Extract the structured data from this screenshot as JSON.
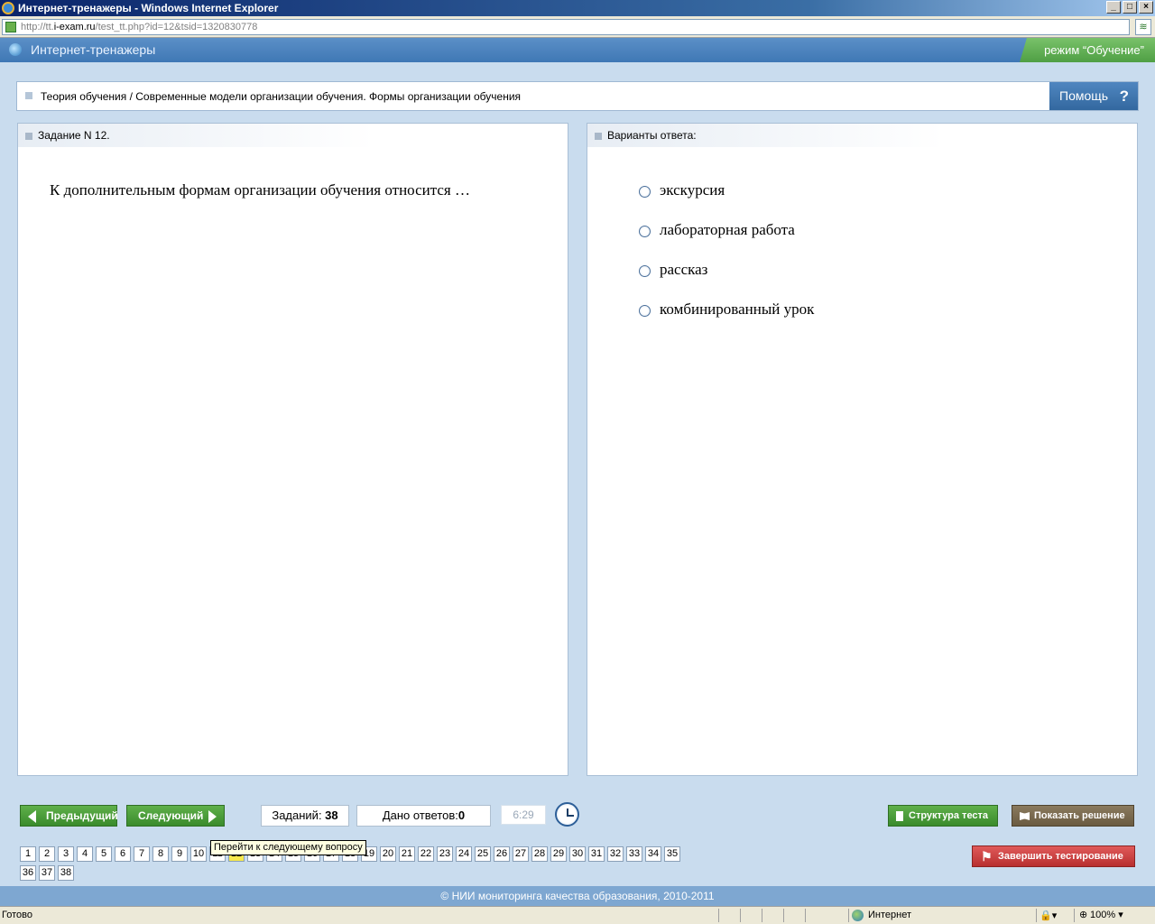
{
  "window": {
    "title": "Интернет-тренажеры - Windows Internet Explorer",
    "buttons": [
      "_",
      "□",
      "×"
    ]
  },
  "address_bar": {
    "url_prefix": "http://tt.",
    "url_domain": "i-exam.ru",
    "url_rest": "/test_tt.php?id=12&tsid=1320830778"
  },
  "app": {
    "title": "Интернет-тренажеры",
    "mode": "режим “Обучение”"
  },
  "breadcrumb": {
    "text": "Теория обучения / Современные модели организации обучения. Формы организации обучения",
    "help_label": "Помощь",
    "help_icon": "?"
  },
  "task": {
    "header": "Задание N 12.",
    "question": "К дополнительным формам организации обучения относится …"
  },
  "answers": {
    "header": "Варианты ответа:",
    "options": [
      "экскурсия",
      "лабораторная работа",
      "рассказ",
      "комбинированный урок"
    ]
  },
  "navigation": {
    "prev_label": "Предыдущий",
    "next_label": "Следующий",
    "tasks_label": "Заданий: ",
    "tasks_count": "38",
    "answers_label": "Дано ответов:",
    "answers_count": "0",
    "timer": "6:29",
    "structure_label": "Структура теста",
    "solution_label": "Показать решение",
    "finish_label": "Завершить тестирование",
    "tooltip": "Перейти к следующему вопросу",
    "current_page": 12
  },
  "pages": [
    "1",
    "2",
    "3",
    "4",
    "5",
    "6",
    "7",
    "8",
    "9",
    "10",
    "11",
    "12",
    "13",
    "14",
    "15",
    "16",
    "17",
    "18",
    "19",
    "20",
    "21",
    "22",
    "23",
    "24",
    "25",
    "26",
    "27",
    "28",
    "29",
    "30",
    "31",
    "32",
    "33",
    "34",
    "35",
    "36",
    "37",
    "38"
  ],
  "footer": "© НИИ мониторинга качества образования, 2010-2011",
  "statusbar": {
    "status": "Готово",
    "zone": "Интернет",
    "zoom": "100%"
  },
  "colors": {
    "header_blue": "#3f78b5",
    "mode_green": "#4f9f44",
    "button_green": "#3a8b2c",
    "solution_brown": "#6a5b41",
    "finish_red": "#b82f2f",
    "current_page": "#f7e94c"
  }
}
